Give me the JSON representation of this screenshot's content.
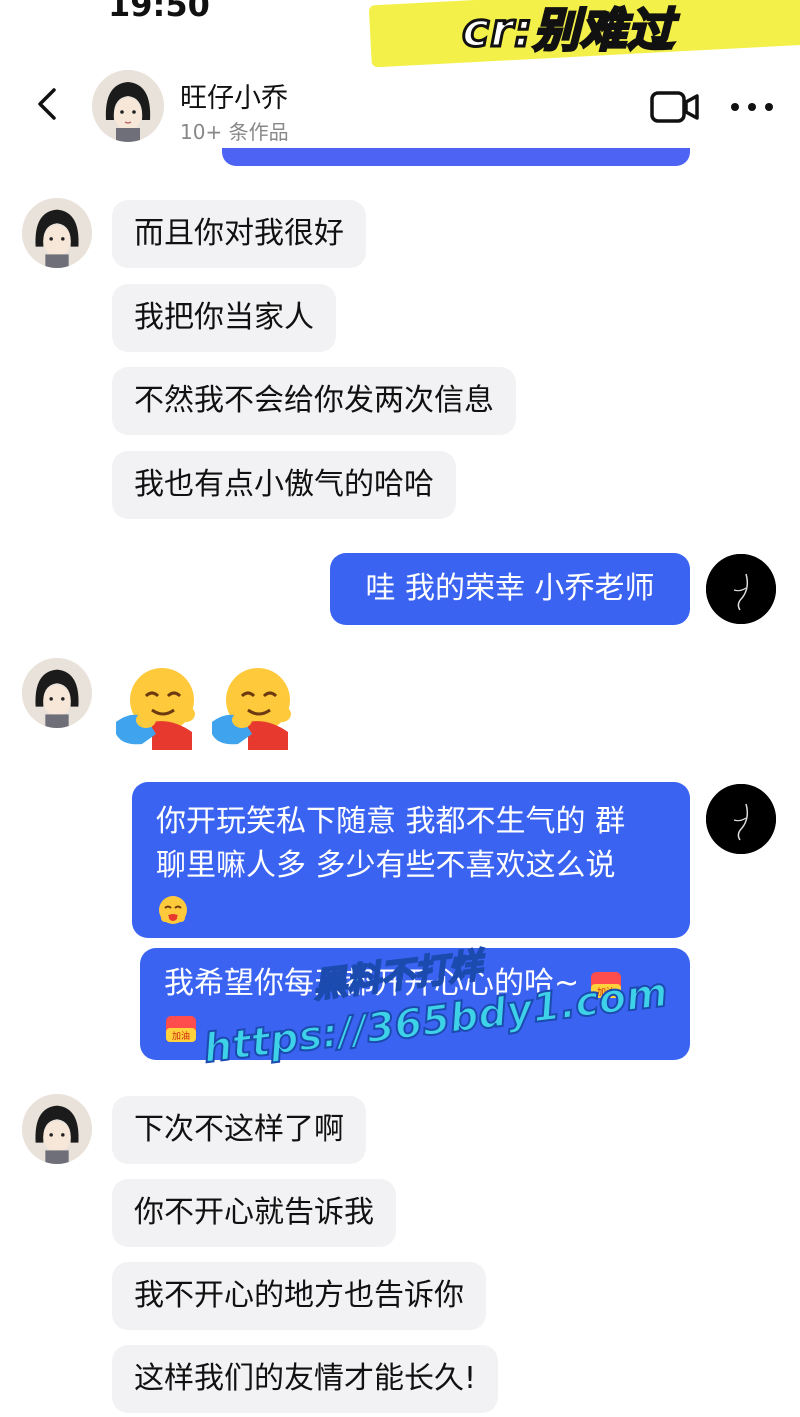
{
  "status_bar": {
    "time": "19:50"
  },
  "overlay": {
    "credit": "cr:别难过"
  },
  "header": {
    "contact_name": "旺仔小乔",
    "subtitle": "10+ 条作品"
  },
  "messages": {
    "m1": "而且你对我很好",
    "m2": "我把你当家人",
    "m3": "不然我不会给你发两次信息",
    "m4": "我也有点小傲气的哈哈",
    "m5": "哇 我的荣幸 小乔老师",
    "m7_line1": "你开玩笑私下随意 我都不生气的 群",
    "m7_line2": "聊里嘛人多 多少有些不喜欢这么说",
    "m8": "我希望你每天都开开心心的哈~",
    "m9": "下次不这样了啊",
    "m10": "你不开心就告诉我",
    "m11": "我不开心的地方也告诉你",
    "m12": "这样我们的友情才能长久!"
  },
  "stickers": {
    "jiayou_text": "加油"
  },
  "watermark": {
    "line1": "黑料不打烊",
    "line2": "https://365bdy1.com"
  },
  "colors": {
    "outgoing_bubble": "#3a63f2",
    "incoming_bubble": "#f2f2f4",
    "watermark": "#3ed2e8"
  }
}
